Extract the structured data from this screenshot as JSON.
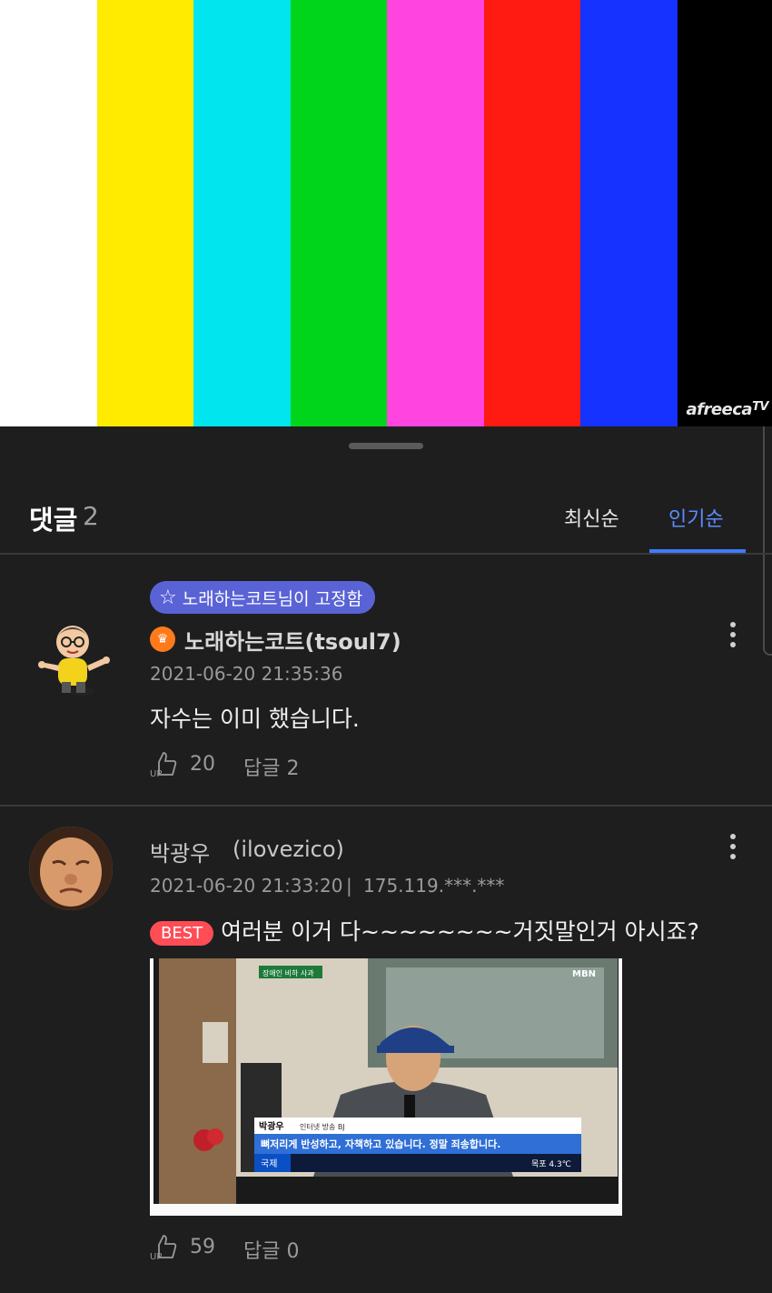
{
  "video": {
    "bars": [
      "#ffffff",
      "#ffeb00",
      "#00e5ee",
      "#00d51c",
      "#ff44e0",
      "#ff1a12",
      "#1632ff",
      "#000000"
    ],
    "watermark": "afreeca",
    "watermark_suffix": "TV"
  },
  "comments_header": {
    "title": "댓글",
    "count": "2",
    "tabs": [
      "최신순",
      "인기순"
    ],
    "active_tab": "인기순"
  },
  "comments": [
    {
      "pinned_label": "노래하는코트님이 고정함",
      "author": "노래하는코트(tsoul7)",
      "timestamp": "2021-06-20 21:35:36",
      "text": "자수는 이미 했습니다.",
      "likes": "20",
      "reply_label": "답글 2"
    },
    {
      "author_name": "박광우",
      "author_id": "(ilovezico)",
      "timestamp": "2021-06-20 21:33:20",
      "ip": "175.119.***.***",
      "badge": "BEST",
      "text": "여러분 이거 다~~~~~~~~거짓말인거 아시죠?",
      "image": {
        "channel_tag": "장애인 비하 사과",
        "broadcaster": "MBN",
        "caption_name": "박광우",
        "caption_role": "인터넷 방송 BJ",
        "caption_text": "뼈저리게 반성하고, 자책하고 있습니다. 정말 죄송합니다.",
        "ticker_label": "국제",
        "weather": "목포 4.3℃"
      },
      "likes": "59",
      "reply_label": "답글 0"
    }
  ],
  "up_icon_text": "UP"
}
